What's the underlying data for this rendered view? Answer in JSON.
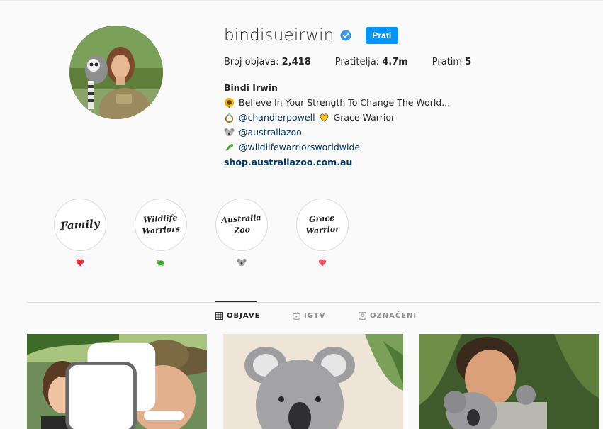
{
  "profile": {
    "username": "bindisueirwin",
    "follow_label": "Prati",
    "stats": {
      "posts_label": "Broj objava:",
      "posts_value": "2,418",
      "followers_label": "Pratitelja:",
      "followers_value": "4.7m",
      "following_label": "Pratim",
      "following_value": "5"
    },
    "bio": {
      "name": "Bindi Irwin",
      "line1": "Believe In Your Strength To Change The World...",
      "line2_link": "@chandlerpowell",
      "line2_text": "Grace Warrior",
      "line3_link": "@australiazoo",
      "line4_link": "@wildlifewarriorsworldwide",
      "url": "shop.australiazoo.com.au"
    }
  },
  "highlights": [
    {
      "title": "Family",
      "icon": "heart-icon"
    },
    {
      "title_line1": "Wildlife",
      "title_line2": "Warriors",
      "icon": "turtle-icon"
    },
    {
      "title_line1": "Australia",
      "title_line2": "Zoo",
      "icon": "koala-icon"
    },
    {
      "title_line1": "Grace",
      "title_line2": "Warrior",
      "icon": "heart-icon"
    }
  ],
  "tabs": [
    {
      "label": "OBJAVE",
      "icon": "grid-icon",
      "active": true
    },
    {
      "label": "IGTV",
      "icon": "igtv-icon",
      "active": false
    },
    {
      "label": "OZNAČENI",
      "icon": "tagged-icon",
      "active": false
    }
  ],
  "colors": {
    "accent": "#0095f6",
    "link": "#00376b",
    "background": "#fafafa",
    "heart": "#ed4956"
  }
}
